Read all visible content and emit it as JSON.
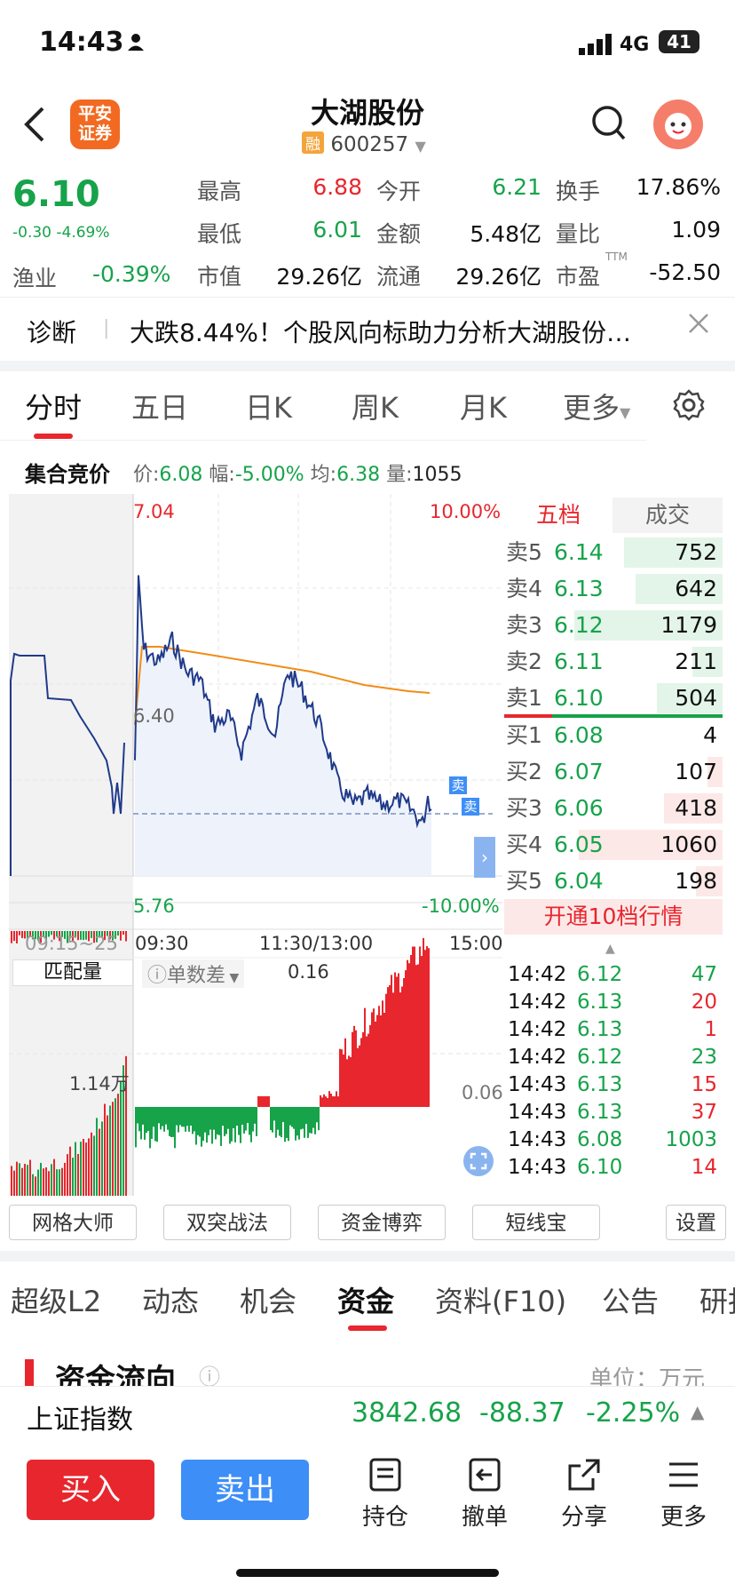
{
  "status_bar": {
    "time": "14:43",
    "network": "4G",
    "battery": "41"
  },
  "header": {
    "logo_text_1": "平安",
    "logo_text_2": "证券",
    "stock_name": "大湖股份",
    "margin_badge": "融",
    "stock_code": "600257"
  },
  "quote": {
    "price": "6.10",
    "change": "-0.30 -4.69%",
    "rows": [
      [
        {
          "label": "最高",
          "value": "6.88",
          "color": "red"
        },
        {
          "label": "今开",
          "value": "6.21",
          "color": "green"
        },
        {
          "label": "换手",
          "value": "17.86%",
          "color": "black"
        }
      ],
      [
        {
          "label": "最低",
          "value": "6.01",
          "color": "green"
        },
        {
          "label": "金额",
          "value": "5.48亿",
          "color": "black"
        },
        {
          "label": "量比",
          "value": "1.09",
          "color": "black"
        }
      ],
      [
        {
          "label": "市值",
          "value": "29.26亿",
          "color": "black"
        },
        {
          "label": "流通",
          "value": "29.26亿",
          "color": "black"
        },
        {
          "label": "市盈",
          "value": "-52.50",
          "color": "black"
        }
      ]
    ],
    "industry_label": "渔业",
    "industry_change": "-0.39%",
    "pe_sup": "TTM"
  },
  "diagnosis": {
    "label": "诊断",
    "text": "大跌8.44%！个股风向标助力分析大湖股份…"
  },
  "chart_tabs": [
    "分时",
    "五日",
    "日K",
    "周K",
    "月K",
    "更多"
  ],
  "auction": {
    "label": "集合竞价",
    "price_label": "价:",
    "price": "6.08",
    "range_label": "幅:",
    "range": "-5.00%",
    "avg_label": "均:",
    "avg": "6.38",
    "vol_label": "量:",
    "vol": "1055"
  },
  "chart_labels": {
    "top_price": "7.04",
    "top_pct": "10.00%",
    "mid_price": "6.40",
    "bottom_price": "5.76",
    "bottom_pct": "-10.00%",
    "time_pre": "09:15~25",
    "time_open": "09:30",
    "time_mid": "11:30/13:00",
    "time_close": "15:00",
    "sell_tag": "卖",
    "sub_tab": "匹配量",
    "sub_indicator": "单数差",
    "sub_value": "0.16",
    "sub_vol": "1.14万",
    "sub_right": "0.06"
  },
  "order_book": {
    "tab_five": "五档",
    "tab_trades": "成交",
    "asks": [
      {
        "label": "卖5",
        "price": "6.14",
        "vol": "752",
        "fill": 0.45
      },
      {
        "label": "卖4",
        "price": "6.13",
        "vol": "642",
        "fill": 0.4
      },
      {
        "label": "卖3",
        "price": "6.12",
        "vol": "1179",
        "fill": 0.68
      },
      {
        "label": "卖2",
        "price": "6.11",
        "vol": "211",
        "fill": 0.14
      },
      {
        "label": "卖1",
        "price": "6.10",
        "vol": "504",
        "fill": 0.3
      }
    ],
    "bids": [
      {
        "label": "买1",
        "price": "6.08",
        "vol": "4",
        "fill": 0.0
      },
      {
        "label": "买2",
        "price": "6.07",
        "vol": "107",
        "fill": 0.07
      },
      {
        "label": "买3",
        "price": "6.06",
        "vol": "418",
        "fill": 0.27
      },
      {
        "label": "买4",
        "price": "6.05",
        "vol": "1060",
        "fill": 0.66
      },
      {
        "label": "买5",
        "price": "6.04",
        "vol": "198",
        "fill": 0.12
      }
    ],
    "open_level10": "开通10档行情",
    "ticks": [
      {
        "time": "14:42",
        "price": "6.12",
        "vol": "47",
        "vcolor": "green"
      },
      {
        "time": "14:42",
        "price": "6.13",
        "vol": "20",
        "vcolor": "red"
      },
      {
        "time": "14:42",
        "price": "6.13",
        "vol": "1",
        "vcolor": "red"
      },
      {
        "time": "14:42",
        "price": "6.12",
        "vol": "23",
        "vcolor": "green"
      },
      {
        "time": "14:43",
        "price": "6.13",
        "vol": "15",
        "vcolor": "red"
      },
      {
        "time": "14:43",
        "price": "6.13",
        "vol": "37",
        "vcolor": "red"
      },
      {
        "time": "14:43",
        "price": "6.08",
        "vol": "1003",
        "vcolor": "green"
      },
      {
        "time": "14:43",
        "price": "6.10",
        "vol": "14",
        "vcolor": "red"
      }
    ]
  },
  "tools": [
    "网格大师",
    "双突战法",
    "资金博弈",
    "短线宝",
    "设置"
  ],
  "feature_tabs": [
    "超级L2",
    "动态",
    "机会",
    "资金",
    "资料(F10)",
    "公告",
    "研报"
  ],
  "fund_flow": {
    "title": "资金流向",
    "unit": "单位：万元"
  },
  "index_bar": {
    "name": "上证指数",
    "value": "3842.68",
    "change": "-88.37",
    "pct": "-2.25%"
  },
  "bottom_bar": {
    "buy": "买入",
    "sell": "卖出",
    "items": [
      "持仓",
      "撤单",
      "分享",
      "更多"
    ]
  },
  "colors": {
    "red": "#e8262d",
    "green": "#16a34a",
    "blue_line": "#1f3a8a",
    "avg_line": "#f28c18",
    "sell_btn": "#3d8ef7"
  }
}
